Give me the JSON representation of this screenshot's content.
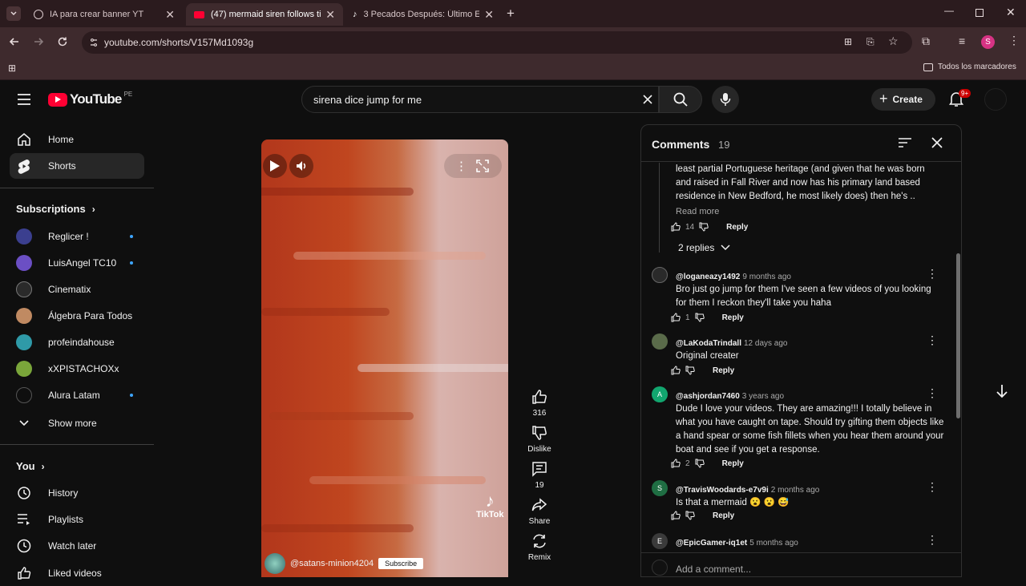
{
  "browser": {
    "tabs": [
      {
        "title": "IA para crear banner YT",
        "active": false
      },
      {
        "title": "(47) mermaid siren follows tik t",
        "active": true
      },
      {
        "title": "3 Pecados Después: Último Edit",
        "active": false
      }
    ],
    "url": "youtube.com/shorts/V157Md1093g",
    "bookmarks_label": "Todos los marcadores"
  },
  "header": {
    "logo_text": "YouTube",
    "region": "PE",
    "search_value": "sirena dice jump for me",
    "create_label": "Create",
    "notif_count": "9+"
  },
  "sidebar": {
    "main": [
      {
        "label": "Home",
        "icon": "home-icon"
      },
      {
        "label": "Shorts",
        "icon": "shorts-icon"
      }
    ],
    "subscriptions_heading": "Subscriptions",
    "subscriptions": [
      {
        "label": "Reglicer !",
        "color": "#3b3f8f",
        "live": true
      },
      {
        "label": "LuisAngel TC10",
        "color": "#6b4fc4",
        "live": true
      },
      {
        "label": "Cinematix",
        "color": "#2a2a2a",
        "live": false
      },
      {
        "label": "Álgebra Para Todos",
        "color": "#c08a62",
        "live": false
      },
      {
        "label": "profeindahouse",
        "color": "#2f9aa8",
        "live": false
      },
      {
        "label": "xXPISTACHOXx",
        "color": "#7aa63a",
        "live": false
      },
      {
        "label": "Alura Latam",
        "color": "#0f0f0f",
        "live": true
      }
    ],
    "show_more": "Show more",
    "you_heading": "You",
    "you_items": [
      {
        "label": "History",
        "icon": "history-icon"
      },
      {
        "label": "Playlists",
        "icon": "playlists-icon"
      },
      {
        "label": "Watch later",
        "icon": "watch-later-icon"
      },
      {
        "label": "Liked videos",
        "icon": "liked-videos-icon"
      }
    ]
  },
  "video": {
    "watermark": "TikTok",
    "channel": "@satans-minion4204",
    "subscribe_label": "Subscribe"
  },
  "actions": {
    "likes": "316",
    "dislike_label": "Dislike",
    "comments": "19",
    "share_label": "Share",
    "remix_label": "Remix"
  },
  "comments": {
    "title": "Comments",
    "count": "19",
    "partial": {
      "text": "least partial Portuguese heritage (and given that he was born and raised in Fall River and now has his primary land based residence in New Bedford, he most likely does) then he's ..",
      "read_more": "Read more",
      "likes": "14",
      "reply": "Reply",
      "replies_toggle": "2 replies"
    },
    "items": [
      {
        "author": "@loganeazy1492",
        "time": "9 months ago",
        "text": "Bro just go jump for them I've seen a few videos of you looking for them I reckon they'll take you haha",
        "likes": "1",
        "reply": "Reply",
        "avatar_letter": "",
        "avatar_color": "#444"
      },
      {
        "author": "@LaKodaTrindall",
        "time": "12 days ago",
        "text": "Original creater",
        "likes": "",
        "reply": "Reply",
        "avatar_letter": "",
        "avatar_color": "#5a6b4a"
      },
      {
        "author": "@ashjordan7460",
        "time": "3 years ago",
        "text": "Dude I love your videos. They are amazing!!! I totally believe in what you have caught on tape. Should try gifting them objects like a hand spear or some fish fillets when you hear them around your boat and see if you get a response.",
        "likes": "2",
        "reply": "Reply",
        "avatar_letter": "A",
        "avatar_color": "#12a66f"
      },
      {
        "author": "@TravisWoodards-e7v9i",
        "time": "2 months ago",
        "text": "Is that a mermaid 😮 😮 😅",
        "likes": "",
        "reply": "Reply",
        "avatar_letter": "S",
        "avatar_color": "#1f6e43"
      },
      {
        "author": "@EpicGamer-iq1et",
        "time": "5 months ago",
        "text": "",
        "likes": "",
        "reply": "Reply",
        "avatar_letter": "E",
        "avatar_color": "#3a3a3a"
      }
    ],
    "add_placeholder": "Add a comment..."
  }
}
